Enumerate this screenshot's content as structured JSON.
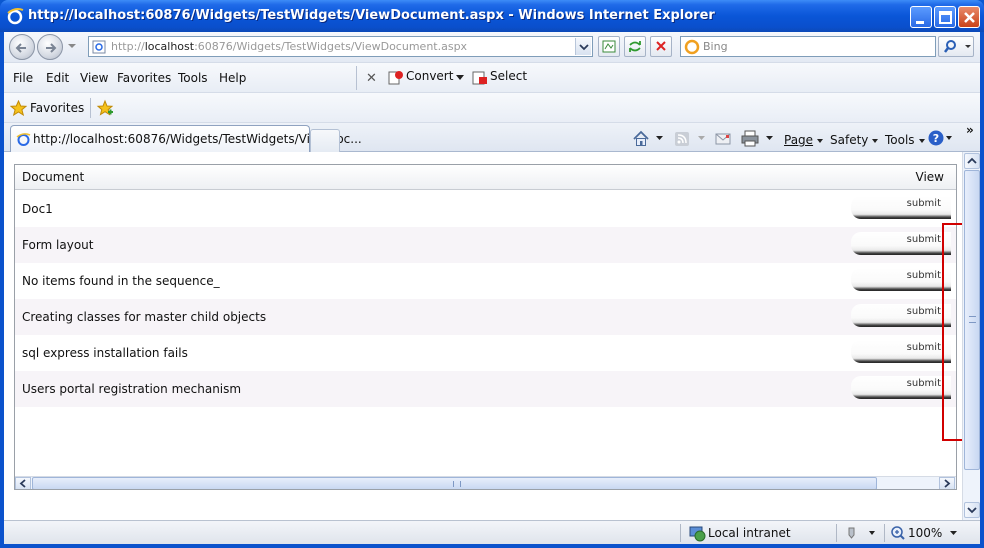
{
  "window": {
    "title": "http://localhost:60876/Widgets/TestWidgets/ViewDocument.aspx - Windows Internet Explorer"
  },
  "address_bar": {
    "url_prefix": "http://",
    "url_host": "localhost",
    "url_rest": ":60876/Widgets/TestWidgets/ViewDocument.aspx"
  },
  "search": {
    "placeholder": "Bing"
  },
  "menu": {
    "items": [
      "File",
      "Edit",
      "View",
      "Favorites",
      "Tools",
      "Help"
    ],
    "convert_label": "Convert",
    "select_label": "Select"
  },
  "favorites_bar": {
    "label": "Favorites"
  },
  "tab": {
    "title": "http://localhost:60876/Widgets/TestWidgets/ViewDoc..."
  },
  "command_bar": {
    "page_label": "Page",
    "safety_label": "Safety",
    "tools_label": "Tools"
  },
  "grid": {
    "columns": [
      "Document",
      "View"
    ],
    "rows": [
      {
        "document": "Doc1",
        "action": "submit"
      },
      {
        "document": "Form layout",
        "action": "submit"
      },
      {
        "document": "No items found in the sequence_",
        "action": "submit"
      },
      {
        "document": "Creating classes for master child objects",
        "action": "submit"
      },
      {
        "document": "sql express installation fails",
        "action": "submit"
      },
      {
        "document": "Users portal registration mechanism",
        "action": "submit"
      }
    ]
  },
  "status_bar": {
    "zone": "Local intranet",
    "zoom": "100%"
  },
  "colors": {
    "titlebar": "#0a56d8",
    "highlight_box": "#d10000"
  }
}
